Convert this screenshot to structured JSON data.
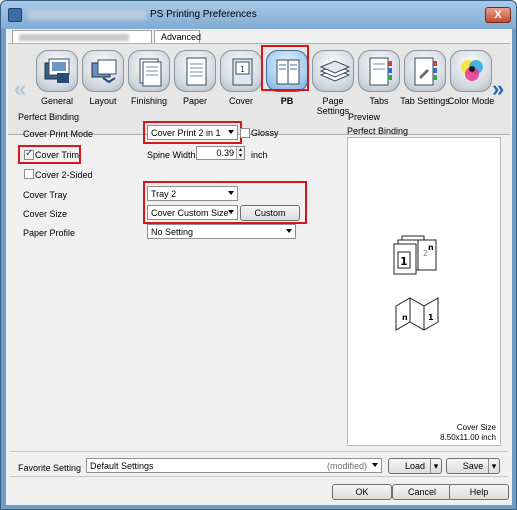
{
  "window": {
    "title": "PS Printing Preferences",
    "close_label": "X"
  },
  "tabs": [
    {
      "label": ""
    },
    {
      "label": "Advanced"
    }
  ],
  "iconbar": {
    "items": [
      {
        "label": "General",
        "icon": "general-icon"
      },
      {
        "label": "Layout",
        "icon": "layout-icon"
      },
      {
        "label": "Finishing",
        "icon": "finishing-icon"
      },
      {
        "label": "Paper",
        "icon": "paper-icon"
      },
      {
        "label": "Cover",
        "icon": "cover-icon"
      },
      {
        "label": "PB",
        "icon": "pb-icon",
        "selected": true
      },
      {
        "label": "Page Settings",
        "icon": "page-settings-icon"
      },
      {
        "label": "Tabs",
        "icon": "tabs-icon"
      },
      {
        "label": "Tab Settings",
        "icon": "tab-settings-icon"
      },
      {
        "label": "Color Mode",
        "icon": "color-mode-icon"
      }
    ]
  },
  "perfect_binding": {
    "group_label": "Perfect Binding",
    "cover_print_mode_label": "Cover Print Mode",
    "cover_print_mode_value": "Cover Print 2 in 1",
    "glossy_label": "Glossy",
    "glossy_checked": false,
    "cover_trim_label": "Cover Trim",
    "cover_trim_checked": true,
    "spine_width_label": "Spine Width",
    "spine_width_value": "0.39",
    "spine_width_unit": "inch",
    "cover_2sided_label": "Cover 2-Sided",
    "cover_2sided_checked": false,
    "cover_tray_label": "Cover Tray",
    "cover_tray_value": "Tray 2",
    "cover_size_label": "Cover Size",
    "cover_size_value": "Cover Custom Size",
    "custom_size_button": "Custom Size...",
    "paper_profile_label": "Paper Profile",
    "paper_profile_value": "No Setting"
  },
  "preview": {
    "group_label": "Preview",
    "title": "Perfect Binding",
    "cover_size_label": "Cover Size",
    "cover_size_value": "8.50x11.00 inch"
  },
  "favorite": {
    "label": "Favorite Setting",
    "value": "Default Settings",
    "modified": "(modified)",
    "load_button": "Load",
    "save_button": "Save"
  },
  "dialog_buttons": {
    "ok": "OK",
    "cancel": "Cancel",
    "help": "Help"
  },
  "colors": {
    "selection_red": "#d8141c",
    "title_bar": "#7fabd3"
  }
}
